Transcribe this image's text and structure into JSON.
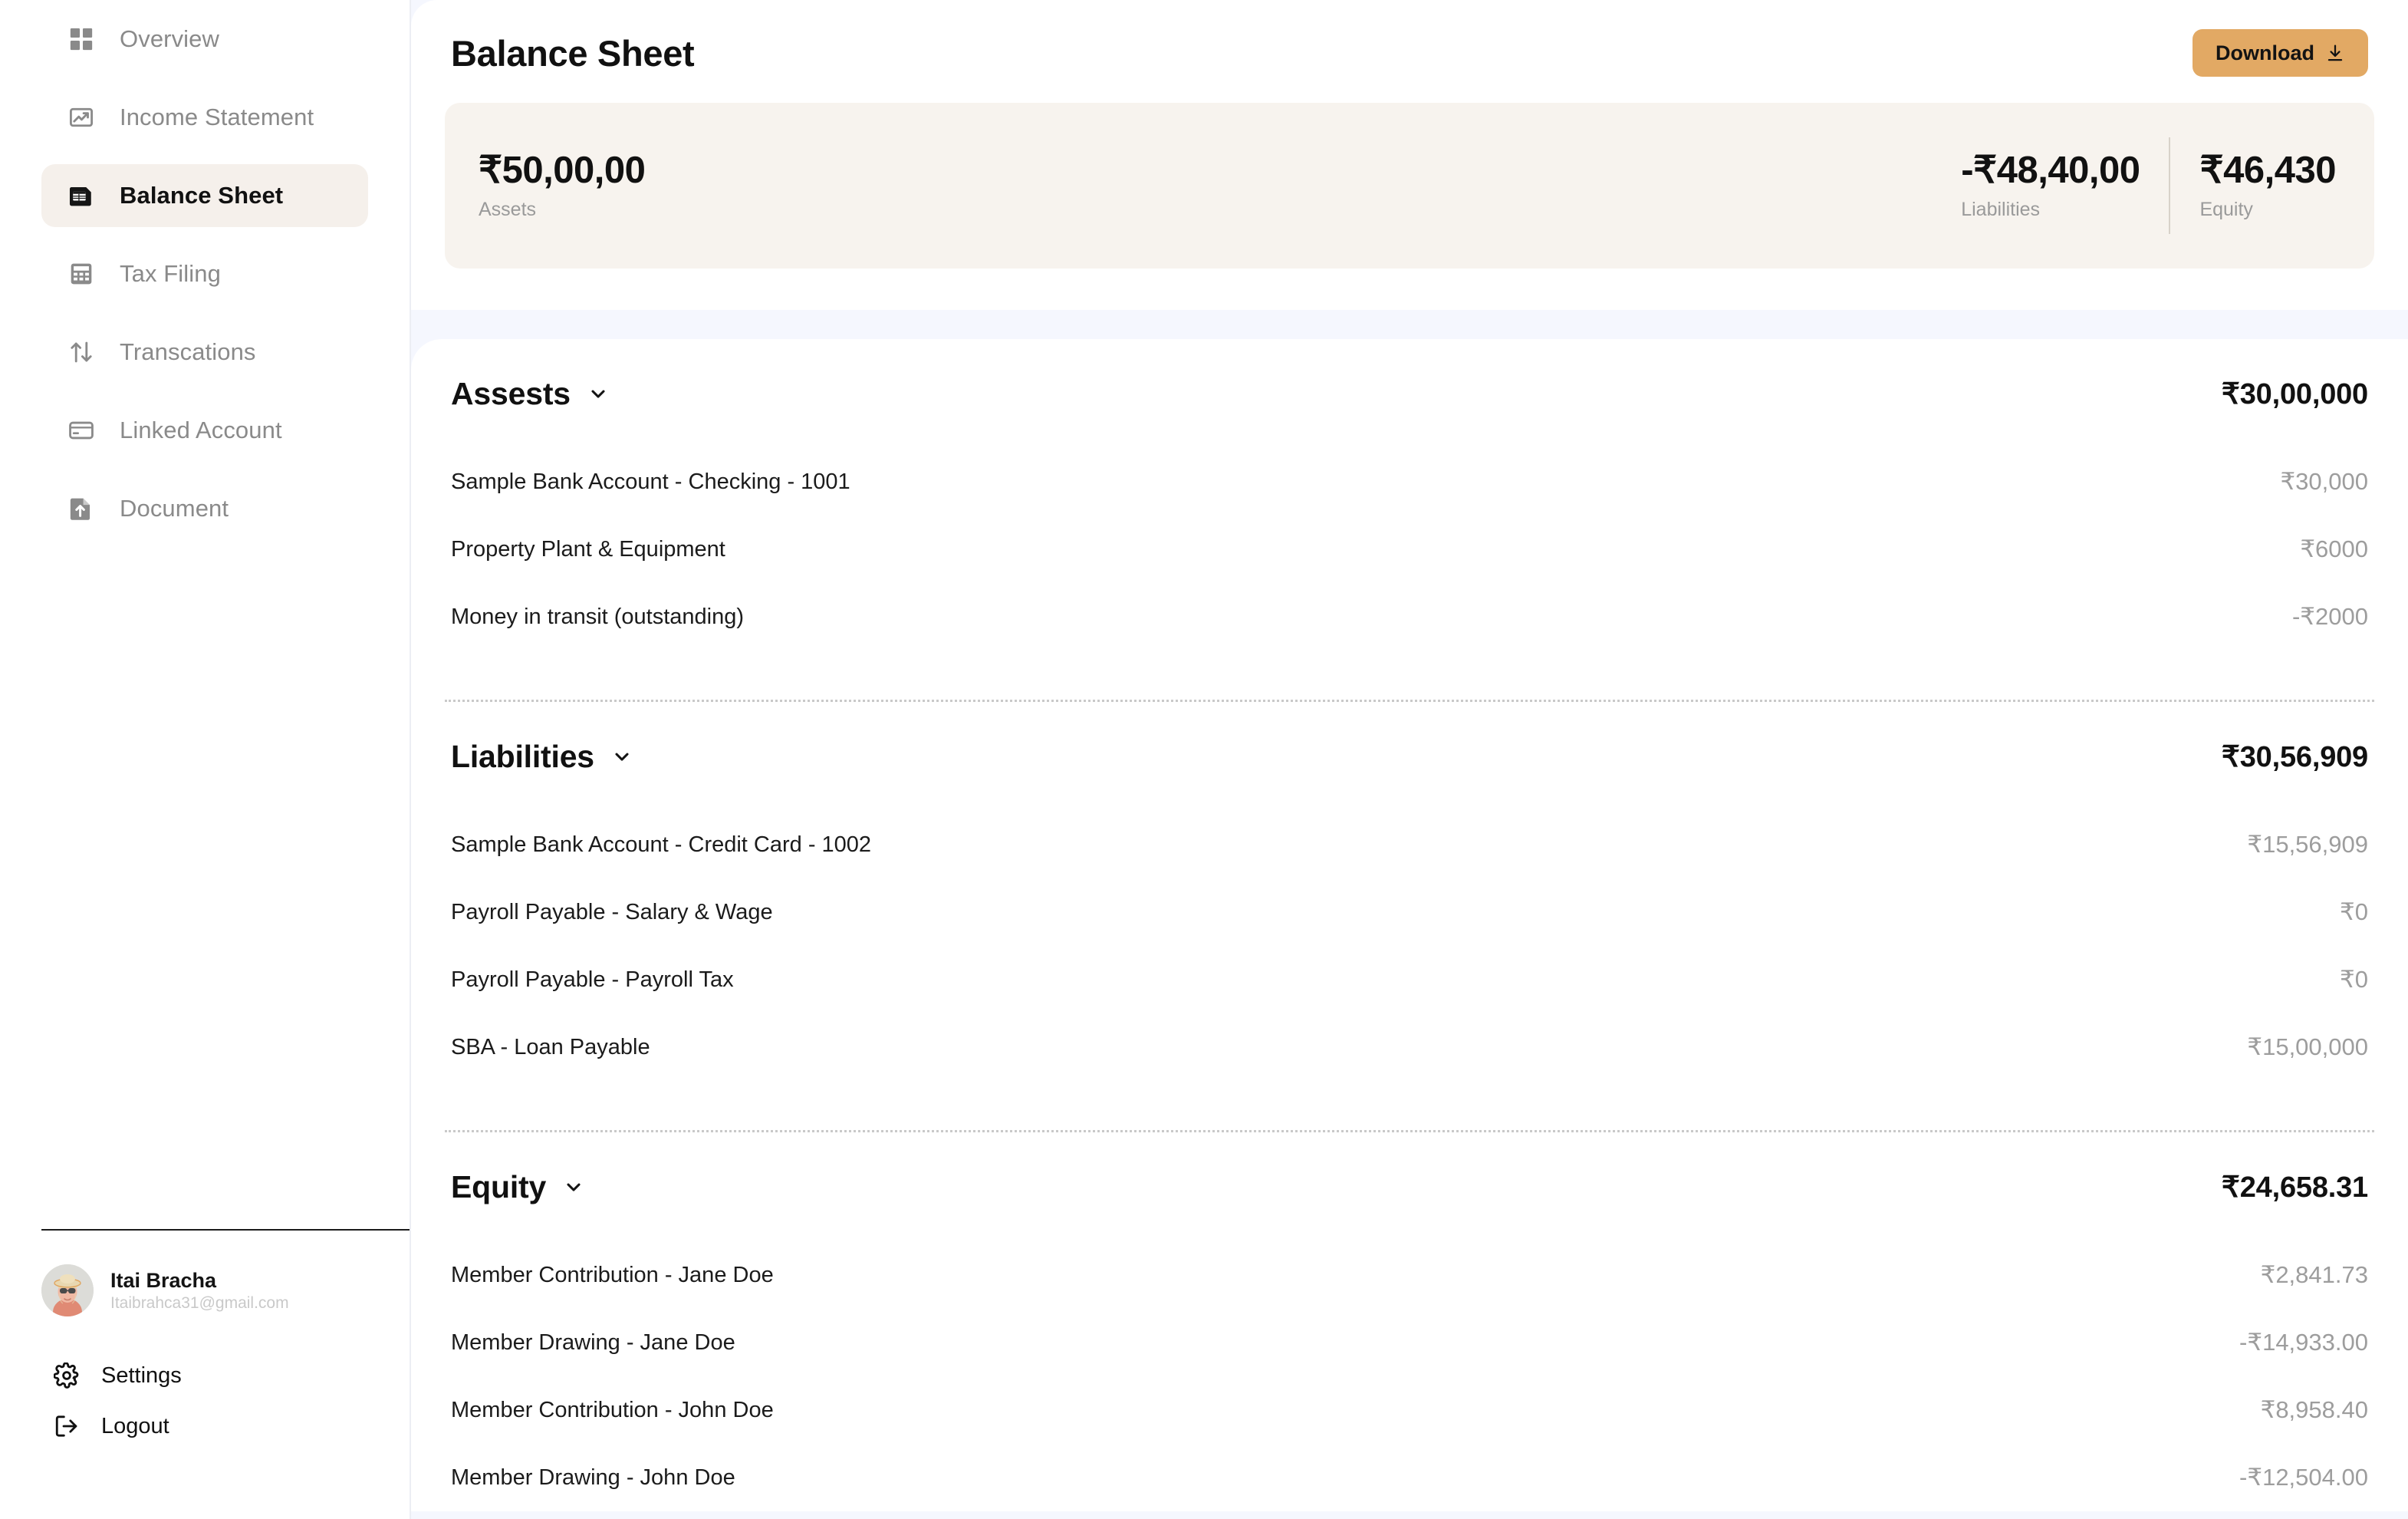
{
  "sidebar": {
    "nav_items": [
      {
        "label": "Overview",
        "icon": "grid-icon",
        "active": false
      },
      {
        "label": "Income Statement",
        "icon": "chart-image-icon",
        "active": false
      },
      {
        "label": "Balance Sheet",
        "icon": "spreadsheet-icon",
        "active": true
      },
      {
        "label": "Tax Filing",
        "icon": "calculator-icon",
        "active": false
      },
      {
        "label": "Transcations",
        "icon": "arrows-up-down-icon",
        "active": false
      },
      {
        "label": "Linked Account",
        "icon": "credit-card-icon",
        "active": false
      },
      {
        "label": "Document",
        "icon": "document-upload-icon",
        "active": false
      }
    ],
    "profile": {
      "name": "Itai Bracha",
      "email": "Itaibrahca31@gmail.com",
      "avatar_icon": "user-avatar"
    },
    "settings_label": "Settings",
    "settings_icon": "gear-icon",
    "logout_label": "Logout",
    "logout_icon": "logout-icon"
  },
  "header": {
    "title": "Balance Sheet",
    "download_label": "Download",
    "download_icon": "download-icon",
    "download_color": "#E2A964"
  },
  "summary": {
    "assets": {
      "value": "₹50,00,00",
      "label": "Assets"
    },
    "liabilities": {
      "value": "-₹48,40,00",
      "label": "Liabilities"
    },
    "equity": {
      "value": "₹46,430",
      "label": "Equity"
    }
  },
  "sections": [
    {
      "title": "Assests",
      "total": "₹30,00,000",
      "chevron_icon": "chevron-down-icon",
      "rows": [
        {
          "label": "Sample Bank Account - Checking - 1001",
          "value": "₹30,000"
        },
        {
          "label": "Property Plant & Equipment",
          "value": "₹6000"
        },
        {
          "label": "Money in transit (outstanding)",
          "value": "-₹2000"
        }
      ]
    },
    {
      "title": "Liabilities",
      "total": "₹30,56,909",
      "chevron_icon": "chevron-down-icon",
      "rows": [
        {
          "label": "Sample Bank Account - Credit Card - 1002",
          "value": "₹15,56,909"
        },
        {
          "label": "Payroll Payable - Salary & Wage",
          "value": "₹0"
        },
        {
          "label": "Payroll Payable - Payroll Tax",
          "value": "₹0"
        },
        {
          "label": "SBA - Loan Payable",
          "value": "₹15,00,000"
        }
      ]
    },
    {
      "title": "Equity",
      "total": "₹24,658.31",
      "chevron_icon": "chevron-down-icon",
      "rows": [
        {
          "label": "Member Contribution - Jane Doe",
          "value": "₹2,841.73"
        },
        {
          "label": "Member Drawing - Jane Doe",
          "value": "-₹14,933.00"
        },
        {
          "label": "Member Contribution - John Doe",
          "value": "₹8,958.40"
        },
        {
          "label": "Member Drawing - John Doe",
          "value": "-₹12,504.00"
        }
      ]
    }
  ]
}
